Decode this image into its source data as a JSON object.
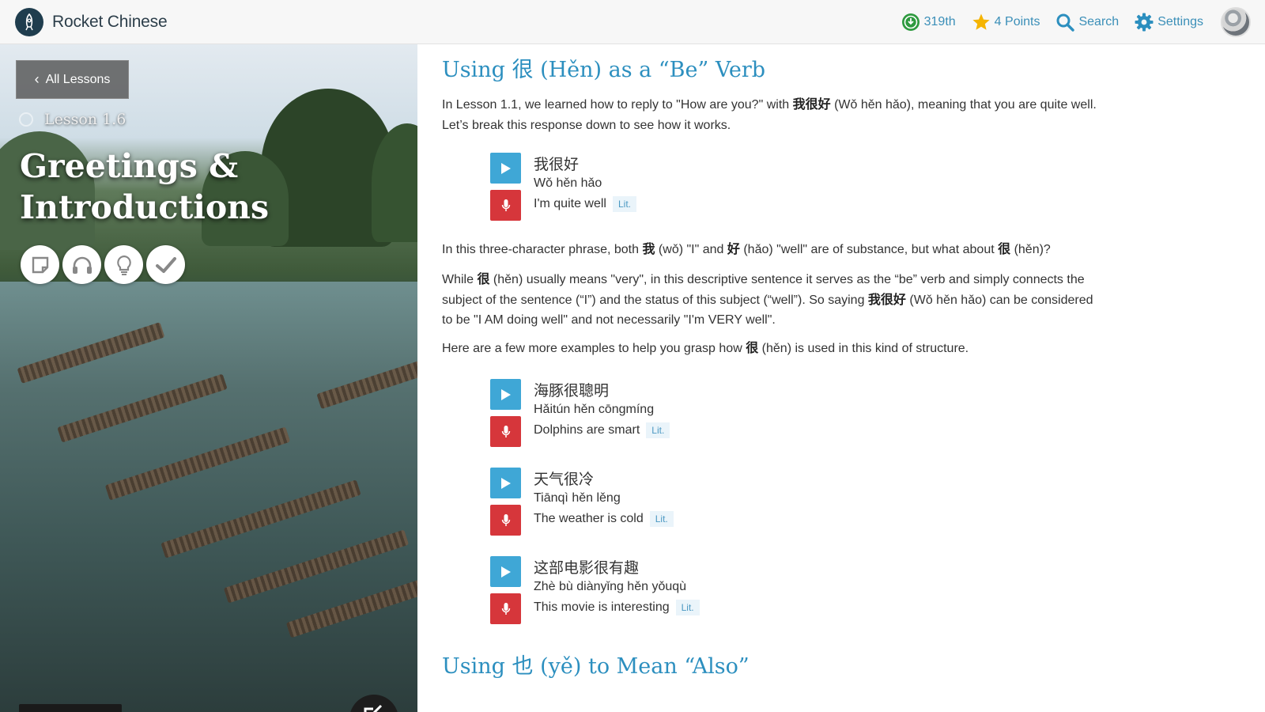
{
  "app": {
    "brand_name": "Rocket Chinese",
    "nav": {
      "rank": "319th",
      "points": "4 Points",
      "search": "Search",
      "settings": "Settings"
    },
    "colors": {
      "accent": "#2c8fbf",
      "nav_link": "#3b8fb8",
      "play": "#3fa7d6",
      "record": "#d6363b",
      "rank": "#2e9a3f",
      "star": "#f5b400"
    }
  },
  "hero": {
    "back_label": "All Lessons",
    "lesson_number": "Lesson 1.6",
    "lesson_title_line1": "Greetings &",
    "lesson_title_line2": "Introductions",
    "tools": [
      "notes-icon",
      "headphones-icon",
      "lightbulb-icon",
      "checkmark-icon"
    ]
  },
  "content": {
    "section1_title": "Using 很 (Hěn) as a “Be” Verb",
    "intro": {
      "before": "In Lesson 1.1, we learned how to reply to \"How are you?\" with ",
      "bold": "我很好",
      "after": " (Wǒ hěn hǎo), meaning that you are quite well. Let’s break this response down to see how it works."
    },
    "phrase1": {
      "hanzi": "我很好",
      "pinyin": "Wǒ hěn hǎo",
      "translation": "I'm quite well",
      "lit": "Lit."
    },
    "para2": {
      "t1": "In this three-character phrase, both ",
      "b1": "我",
      "t2": " (wǒ) \"I\" and ",
      "b2": "好",
      "t3": " (hǎo) \"well\" are of substance, but what about ",
      "b3": "很",
      "t4": " (hěn)?"
    },
    "para3": {
      "t1": "While ",
      "b1": "很",
      "t2": " (hěn) usually means \"very\", in this descriptive sentence it serves as the “be” verb and simply connects the subject of the sentence (“I”) and the status of this subject (“well”). So saying ",
      "b2": "我很好",
      "t3": " (Wǒ hěn hǎo) can be considered to be \"I AM doing well\" and not necessarily \"I'm VERY well\"."
    },
    "para4": {
      "t1": "Here are a few more examples to help you grasp how ",
      "b1": "很",
      "t2": " (hěn) is used in this kind of structure."
    },
    "phrase2": {
      "hanzi": "海豚很聰明",
      "pinyin": "Hǎitún hěn cōngmíng",
      "translation": "Dolphins are smart",
      "lit": "Lit."
    },
    "phrase3": {
      "hanzi": "天气很冷",
      "pinyin": "Tiānqì hěn lěng",
      "translation": "The weather is cold",
      "lit": "Lit."
    },
    "phrase4": {
      "hanzi": "这部电影很有趣",
      "pinyin": "Zhè bù diànyǐng hěn yǒuqù",
      "translation": "This movie is interesting",
      "lit": "Lit."
    },
    "section2_title": "Using 也 (yě) to Mean “Also”"
  }
}
